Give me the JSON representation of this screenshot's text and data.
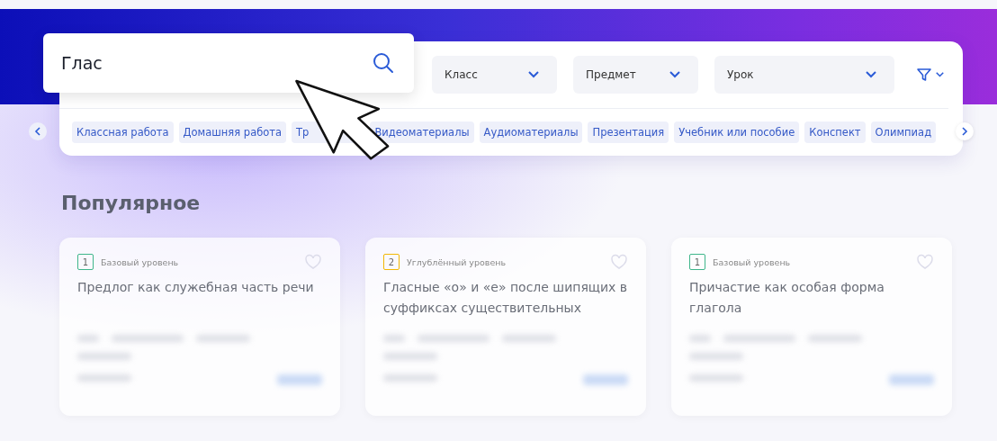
{
  "search": {
    "value": "Глас"
  },
  "filters": [
    {
      "label": "Класс"
    },
    {
      "label": "Предмет"
    },
    {
      "label": "Урок"
    }
  ],
  "chips": [
    {
      "label": "Классная работа"
    },
    {
      "label": "Домашняя работа"
    },
    {
      "label": "Тр"
    },
    {
      "label": "Видеоматериалы"
    },
    {
      "label": "Аудиоматериалы"
    },
    {
      "label": "Презентация"
    },
    {
      "label": "Учебник или пособие"
    },
    {
      "label": "Конспект"
    },
    {
      "label": "Олимпиад"
    }
  ],
  "section_title": "Популярное",
  "cards": [
    {
      "level_number": "1",
      "level_label": "Базовый уровень",
      "color": "#3fb68b",
      "title": "Предлог как служебная часть речи",
      "favorite": false
    },
    {
      "level_number": "2",
      "level_label": "Углублённый уровень",
      "color": "#f2b705",
      "title": "Гласные «о» и «е» после шипящих в суффиксах существительных",
      "favorite": false
    },
    {
      "level_number": "1",
      "level_label": "Базовый уровень",
      "color": "#3fb68b",
      "title": "Причастие как особая форма глагола",
      "favorite": false
    }
  ]
}
